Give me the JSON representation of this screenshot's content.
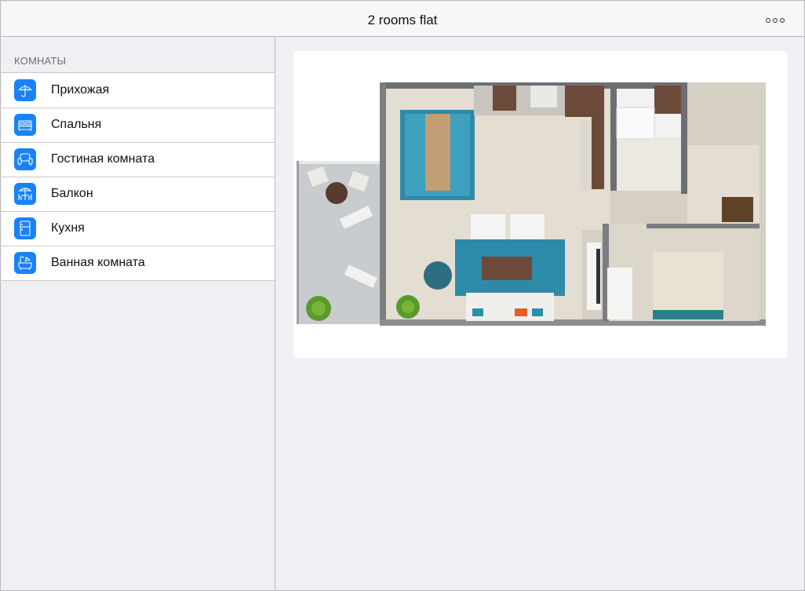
{
  "navbar": {
    "title": "2 rooms flat",
    "more_icon": "ellipsis-circle-icon"
  },
  "sidebar": {
    "section_header": "КОМНАТЫ",
    "items": [
      {
        "label": "Прихожая",
        "icon": "umbrella-icon"
      },
      {
        "label": "Спальня",
        "icon": "bed-icon"
      },
      {
        "label": "Гостиная комната",
        "icon": "armchair-icon"
      },
      {
        "label": "Балкон",
        "icon": "patio-table-icon"
      },
      {
        "label": "Кухня",
        "icon": "fridge-icon"
      },
      {
        "label": "Ванная комната",
        "icon": "bathtub-icon"
      }
    ]
  },
  "colors": {
    "accent": "#1a82f7",
    "background": "#efeff4",
    "navbar": "#f7f7f7"
  }
}
